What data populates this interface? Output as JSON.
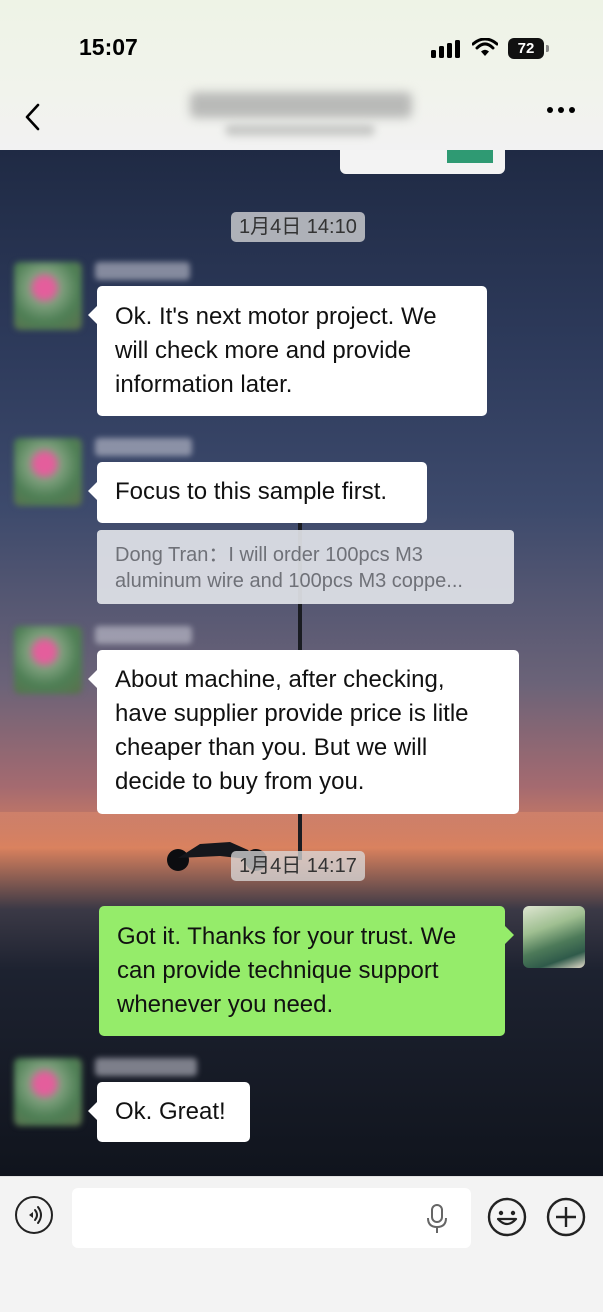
{
  "status_bar": {
    "time": "15:07",
    "battery": "72"
  },
  "header": {
    "back_icon": "chevron-left-icon",
    "more_icon": "more-dots-icon"
  },
  "timestamps": [
    "1月4日 14:10",
    "1月4日 14:17"
  ],
  "messages": [
    {
      "side": "left",
      "lines": [
        "Ok. It's next motor project. We",
        "will check more and provide",
        "information later."
      ]
    },
    {
      "side": "left",
      "lines": [
        "Focus to this sample first."
      ]
    },
    {
      "side": "left",
      "quote": {
        "lines": [
          "Dong Tran：I will order 100pcs M3",
          "aluminum wire and 100pcs M3 coppe..."
        ]
      }
    },
    {
      "side": "left",
      "lines": [
        "About machine, after checking,",
        "have supplier provide price is litle",
        "cheaper than you. But we will",
        "decide to buy from you."
      ]
    },
    {
      "side": "right",
      "lines": [
        "Got it. Thanks for your trust. We",
        "can provide technique support",
        "whenever you need."
      ]
    },
    {
      "side": "left",
      "lines": [
        "Ok. Great!"
      ]
    }
  ],
  "input_bar": {
    "voice_icon": "voice-icon",
    "mic_icon": "microphone-icon",
    "emoji_icon": "emoji-icon",
    "plus_icon": "plus-icon"
  },
  "colors": {
    "outgoing_bubble": "#95ec6a",
    "incoming_bubble": "#ffffff",
    "timestamp_chip": "#dcdcdc"
  }
}
